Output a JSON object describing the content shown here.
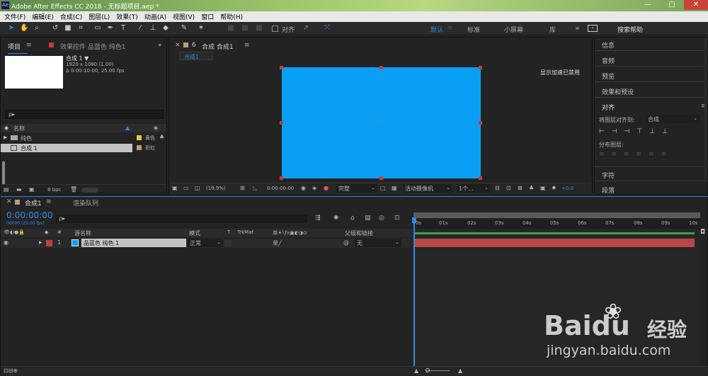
{
  "app": {
    "title": "Adobe After Effects CC 2018 - 无标题项目.aep *",
    "icon": "Ae"
  },
  "window_controls": {
    "min": "—",
    "max": "□",
    "close": "✕"
  },
  "menu": [
    "文件(F)",
    "编辑(E)",
    "合成(C)",
    "图层(L)",
    "效果(T)",
    "动画(A)",
    "视图(V)",
    "窗口",
    "帮助(H)"
  ],
  "toolbar": {
    "snap_label": "对齐",
    "workspaces": [
      "默认",
      "标准",
      "小屏幕",
      "库"
    ],
    "more": "»",
    "search_placeholder": "搜索帮助"
  },
  "project": {
    "tab": "项目",
    "effects_tab": "效果控件 品蓝色 纯色1",
    "comp_name": "合成 1 ▼",
    "comp_dims": "1920 x 1080 (1.00)",
    "comp_dur": "Δ 0:00:10:00, 25.00 fps",
    "search": "ρ▸",
    "col_name": "名称",
    "items": [
      {
        "name": "纯色",
        "label": "黄色",
        "color": "#e2c64a",
        "type": "folder"
      },
      {
        "name": "合成 1",
        "label": "彩虹",
        "color": "#b8a070",
        "type": "comp"
      }
    ],
    "bpc": "8 bpc"
  },
  "comp_panel": {
    "tab": "合成 合成1",
    "subtab": "合成1",
    "notice": "显示加速已禁用",
    "zoom": "(19.9%)",
    "timecode": "0:00:00:00",
    "quality": "完整",
    "camera": "活动摄像机",
    "views": "1个...",
    "exposure": "+0.0",
    "solid_color": "#0a9ff5"
  },
  "right_panel": {
    "items": [
      "信息",
      "音频",
      "预览",
      "效果和预设",
      "对齐",
      "字符",
      "段落"
    ],
    "align_to_label": "将图层对齐到:",
    "align_to_value": "合成",
    "distribute_label": "分布图层:"
  },
  "timeline": {
    "tab": "合成1",
    "render_tab": "渲染队列",
    "timecode": "0:00:00:00",
    "frame_info": "00000 (25.00 fps)",
    "search": "ρ▸",
    "cols": {
      "src": "源名称",
      "mode": "模式",
      "t": "T",
      "trkmat": "TrkMat",
      "parent": "父级和链接"
    },
    "layer": {
      "num": "1",
      "name": "品蓝色 纯色 1",
      "mode": "正常",
      "parent": "无",
      "color": "#0a9ff5",
      "label_color": "#c0403a"
    },
    "ruler": [
      "0s",
      "01s",
      "02s",
      "03s",
      "04s",
      "05s",
      "06s",
      "07s",
      "08s",
      "09s",
      "10s"
    ]
  },
  "watermark": {
    "brand": "Baidu",
    "cn": "经验",
    "url": "jingyan.baidu.com"
  }
}
